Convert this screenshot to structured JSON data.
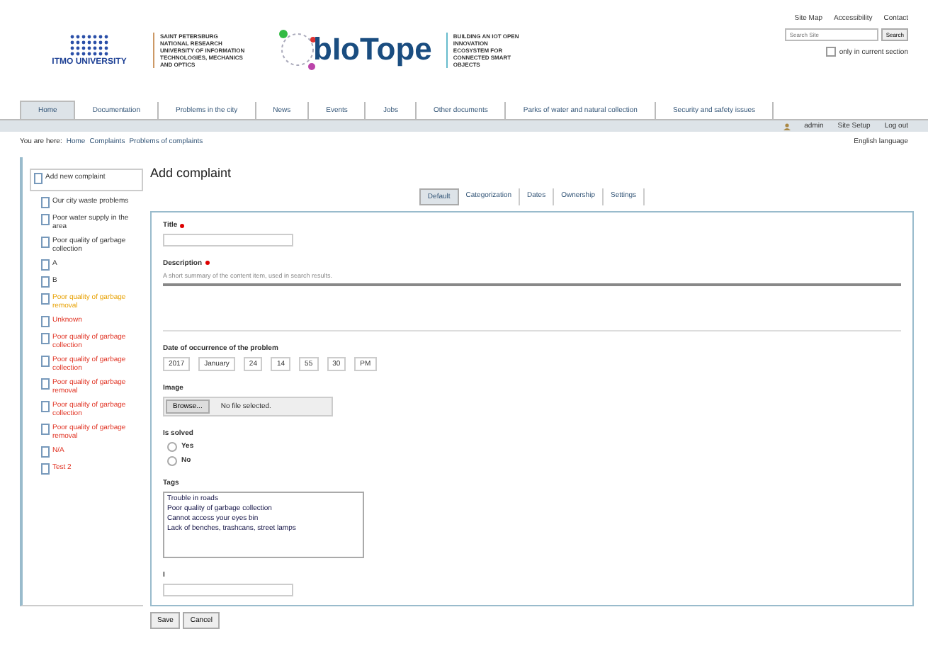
{
  "header": {
    "university": "ITMO UNIVERSITY",
    "university_caption": "SAINT PETERSBURG NATIONAL RESEARCH UNIVERSITY OF INFORMATION TECHNOLOGIES, MECHANICS AND OPTICS",
    "brand": "bIoTope",
    "brand_caption": "BUILDING AN IOT OPEN INNOVATION ECOSYSTEM FOR CONNECTED SMART OBJECTS"
  },
  "site_actions": [
    "Site Map",
    "Accessibility",
    "Contact"
  ],
  "search": {
    "placeholder": "Search Site",
    "button": "Search",
    "option": "only in current section",
    "checked": false
  },
  "nav": [
    {
      "label": "Home",
      "selected": true
    },
    {
      "label": "Documentation",
      "selected": false
    },
    {
      "label": "Problems in the city",
      "selected": false
    },
    {
      "label": "News",
      "selected": false
    },
    {
      "label": "Events",
      "selected": false
    },
    {
      "label": "Jobs",
      "selected": false
    },
    {
      "label": "Other documents",
      "selected": false
    },
    {
      "label": "Parks of water and natural collection",
      "selected": false
    },
    {
      "label": "Security and safety issues",
      "selected": false
    }
  ],
  "user_bar": [
    "admin",
    "Site Setup",
    "Log out"
  ],
  "breadcrumb": {
    "prefix": "You are here:",
    "items": [
      "Home",
      "Complaints",
      "Problems of complaints"
    ]
  },
  "language": "English language",
  "sidebar": {
    "items": [
      {
        "label": "Add new complaint",
        "selected": true,
        "kind": "normal"
      },
      {
        "label": "Our city waste problems",
        "selected": false,
        "kind": "normal"
      },
      {
        "label": "Poor water supply in the area",
        "selected": false,
        "kind": "normal"
      },
      {
        "label": "Poor quality of garbage collection",
        "selected": false,
        "kind": "normal"
      },
      {
        "label": "A",
        "selected": false,
        "kind": "normal"
      },
      {
        "label": "B",
        "selected": false,
        "kind": "normal"
      },
      {
        "label": "Poor quality of garbage removal",
        "selected": false,
        "kind": "pending"
      },
      {
        "label": "Unknown",
        "selected": false,
        "kind": "open"
      },
      {
        "label": "Poor quality of garbage collection",
        "selected": false,
        "kind": "open"
      },
      {
        "label": "Poor quality of garbage collection",
        "selected": false,
        "kind": "open"
      },
      {
        "label": "Poor quality of garbage removal",
        "selected": false,
        "kind": "open"
      },
      {
        "label": "Poor quality of garbage collection",
        "selected": false,
        "kind": "open"
      },
      {
        "label": "Poor quality of garbage removal",
        "selected": false,
        "kind": "open"
      },
      {
        "label": "N/A",
        "selected": false,
        "kind": "open"
      },
      {
        "label": "Test 2",
        "selected": false,
        "kind": "open"
      }
    ]
  },
  "form": {
    "title": "Add complaint",
    "tabs": [
      {
        "label": "Default",
        "selected": true
      },
      {
        "label": "Categorization",
        "selected": false
      },
      {
        "label": "Dates",
        "selected": false
      },
      {
        "label": "Ownership",
        "selected": false
      },
      {
        "label": "Settings",
        "selected": false
      }
    ],
    "title_label": "Title",
    "description_label": "Description",
    "description_hint": "A short summary of the content item, used in search results.",
    "date_label": "Date of occurrence of the problem",
    "date_parts": [
      "2017",
      "January",
      "24",
      "14",
      "55",
      "30",
      "PM"
    ],
    "image_label": "Image",
    "browse": "Browse...",
    "no_file": "No file selected.",
    "solved_label": "Is solved",
    "solved_options": [
      {
        "label": "Yes",
        "selected": false
      },
      {
        "label": "No",
        "selected": false
      }
    ],
    "tags_label": "Tags",
    "tags": [
      "Trouble in roads",
      "Poor quality of garbage collection",
      "Cannot access your eyes bin",
      "Lack of benches, trashcans, street lamps"
    ],
    "extra_label": "I",
    "buttons": [
      "Save",
      "Cancel"
    ]
  }
}
